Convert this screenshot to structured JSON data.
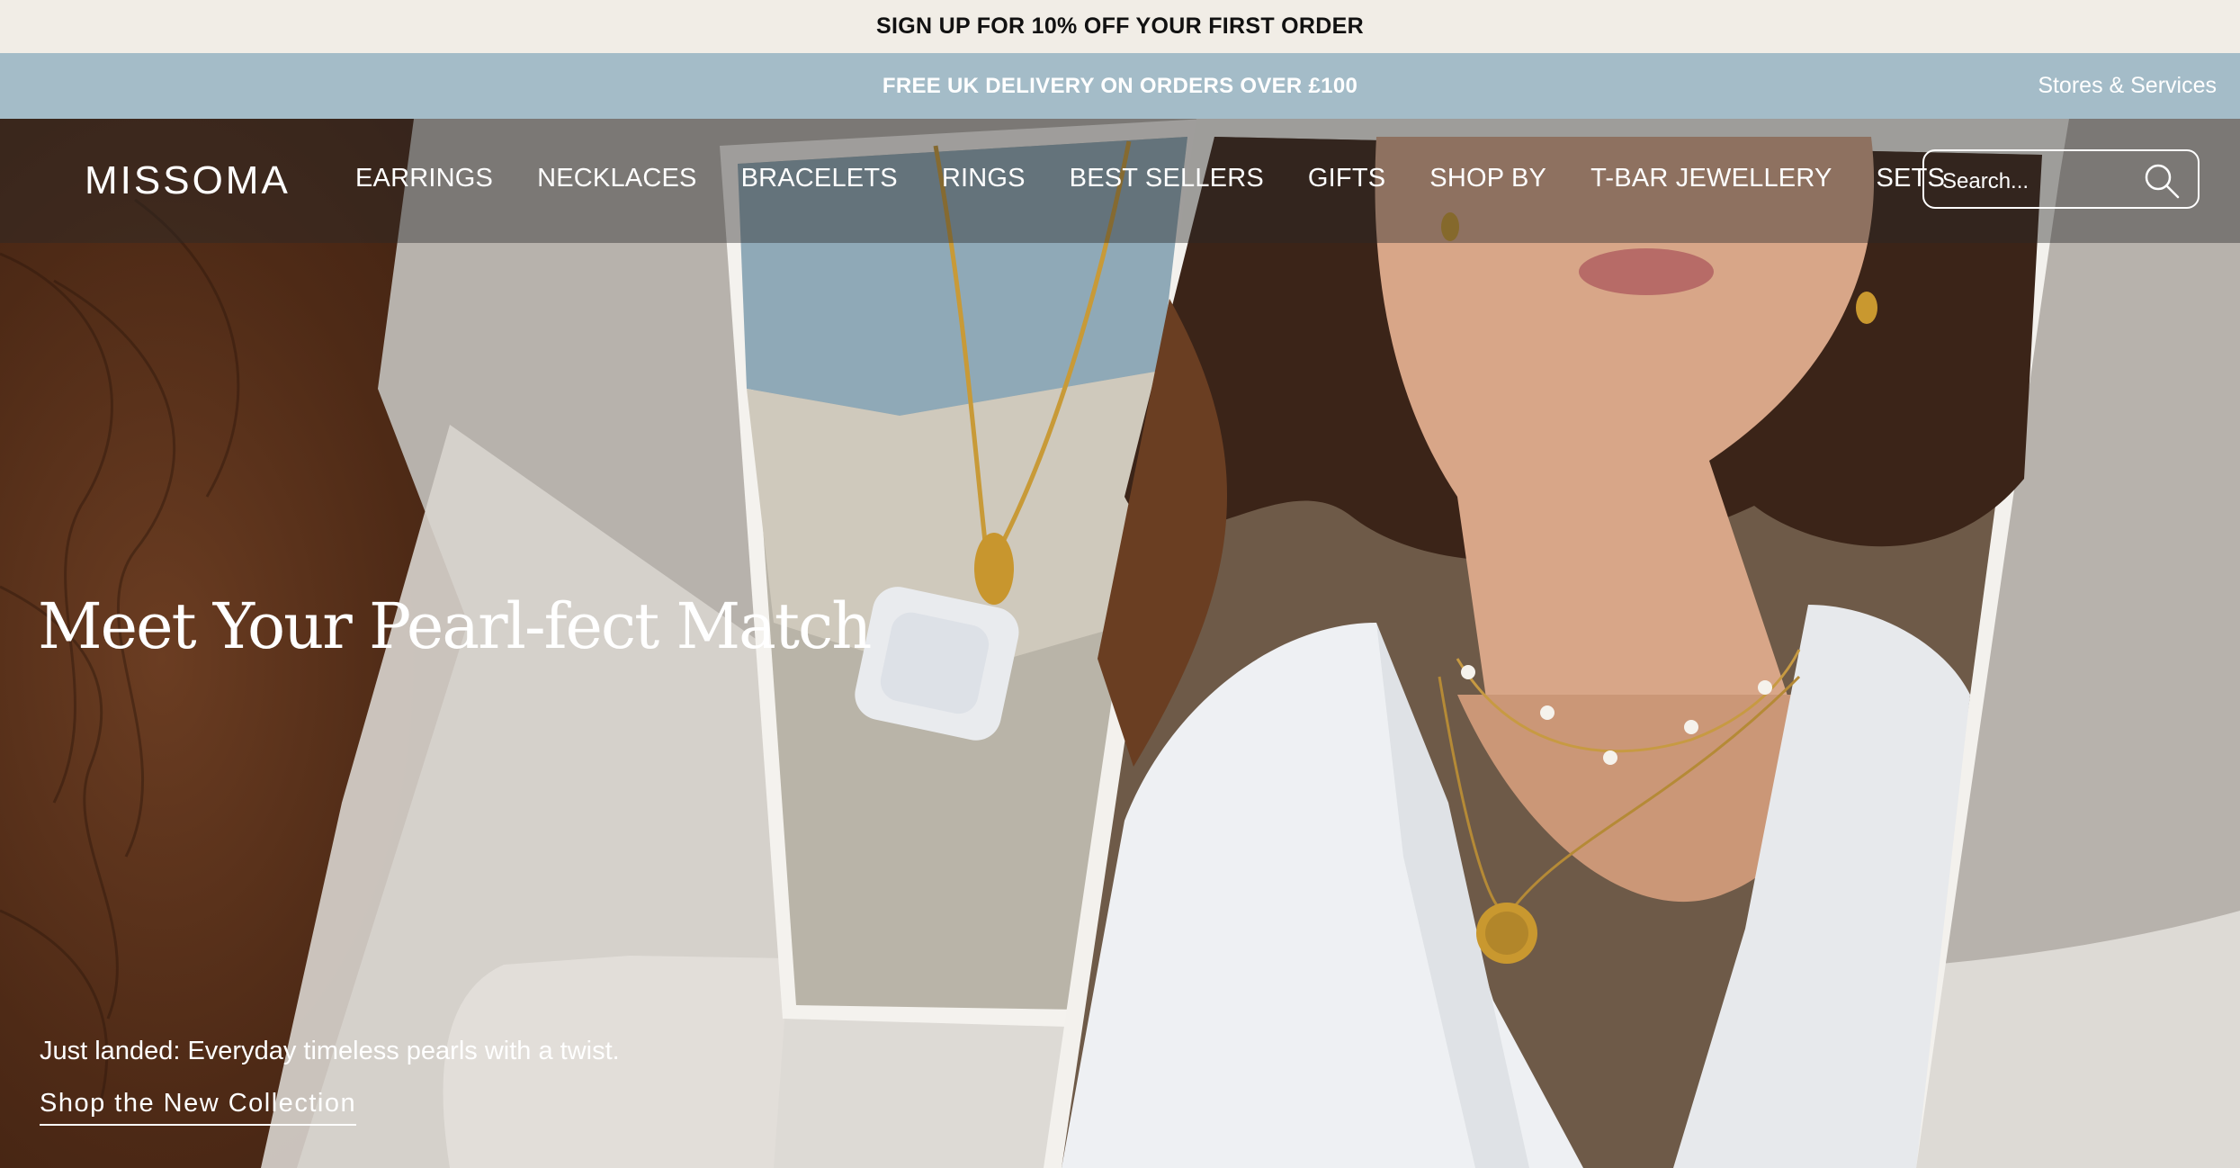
{
  "promo": {
    "text": "SIGN UP FOR 10% OFF YOUR FIRST ORDER"
  },
  "delivery": {
    "text": "FREE UK DELIVERY ON ORDERS OVER £100",
    "stores_link": "Stores & Services"
  },
  "header": {
    "logo": "MISSOMA",
    "menu": [
      "EARRINGS",
      "NECKLACES",
      "BRACELETS",
      "RINGS",
      "BEST SELLERS",
      "GIFTS",
      "SHOP BY",
      "T-BAR JEWELLERY",
      "SETS"
    ],
    "search": {
      "placeholder": "Search...",
      "icon": "search-icon"
    }
  },
  "hero": {
    "title": "Meet Your Pearl-fect Match",
    "subtitle": "Just landed: Everyday timeless pearls with a twist.",
    "cta": "Shop the New Collection"
  },
  "colors": {
    "promo_bg": "#f1ede6",
    "delivery_bg": "#a4bcc8",
    "nav_overlay": "rgba(40,40,40,0.42)",
    "text_light": "#ffffff"
  }
}
